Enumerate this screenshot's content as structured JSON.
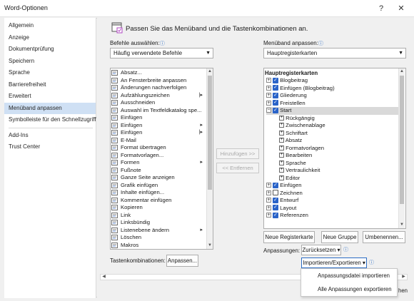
{
  "window": {
    "title": "Word-Optionen",
    "help": "?",
    "close": "✕"
  },
  "nav": {
    "items": [
      "Allgemein",
      "Anzeige",
      "Dokumentprüfung",
      "Speichern",
      "Sprache",
      "Barrierefreiheit",
      "Erweitert",
      "Menüband anpassen",
      "Symbolleiste für den Schnellzugriff"
    ],
    "items2": [
      "Add-Ins",
      "Trust Center"
    ],
    "selected_index": 7
  },
  "header": {
    "text": "Passen Sie das Menüband und die Tastenkombinationen an."
  },
  "left": {
    "label": "Befehle auswählen:",
    "select_value": "Häufig verwendete Befehle",
    "commands": [
      {
        "label": "Absatz...",
        "icon": "paragraph-icon",
        "sub": ""
      },
      {
        "label": "An Fensterbreite anpassen",
        "icon": "fit-width-icon",
        "sub": ""
      },
      {
        "label": "Änderungen nachverfolgen",
        "icon": "track-changes-icon",
        "sub": ""
      },
      {
        "label": "Aufzählungszeichen",
        "icon": "bullets-icon",
        "sub": "|▸"
      },
      {
        "label": "Ausschneiden",
        "icon": "cut-icon",
        "sub": ""
      },
      {
        "label": "Auswahl im Textfeldkatalog spe...",
        "icon": "textbox-icon",
        "sub": ""
      },
      {
        "label": "Einfügen",
        "icon": "paste-icon",
        "sub": ""
      },
      {
        "label": "Einfügen",
        "icon": "paste-icon",
        "sub": "▸"
      },
      {
        "label": "Einfügen",
        "icon": "paste-icon",
        "sub": "|▸"
      },
      {
        "label": "E-Mail",
        "icon": "email-icon",
        "sub": ""
      },
      {
        "label": "Format übertragen",
        "icon": "format-painter-icon",
        "sub": ""
      },
      {
        "label": "Formatvorlagen...",
        "icon": "styles-icon",
        "sub": ""
      },
      {
        "label": "Formen",
        "icon": "shapes-icon",
        "sub": "▸"
      },
      {
        "label": "Fußnote",
        "icon": "footnote-icon",
        "sub": ""
      },
      {
        "label": "Ganze Seite anzeigen",
        "icon": "whole-page-icon",
        "sub": ""
      },
      {
        "label": "Grafik einfügen",
        "icon": "picture-icon",
        "sub": ""
      },
      {
        "label": "Inhalte einfügen...",
        "icon": "paste-special-icon",
        "sub": ""
      },
      {
        "label": "Kommentar einfügen",
        "icon": "comment-icon",
        "sub": ""
      },
      {
        "label": "Kopieren",
        "icon": "copy-icon",
        "sub": ""
      },
      {
        "label": "Link",
        "icon": "link-icon",
        "sub": ""
      },
      {
        "label": "Linksbündig",
        "icon": "align-left-icon",
        "sub": ""
      },
      {
        "label": "Listenebene ändern",
        "icon": "list-level-icon",
        "sub": "▸"
      },
      {
        "label": "Löschen",
        "icon": "delete-icon",
        "sub": ""
      },
      {
        "label": "Makros",
        "icon": "macros-icon",
        "sub": ""
      }
    ],
    "shortcut_label": "Tastenkombinationen:",
    "shortcut_button": "Anpassen..."
  },
  "middle": {
    "add": "Hinzufügen >>",
    "remove": "<< Entfernen"
  },
  "right": {
    "label": "Menüband anpassen:",
    "select_value": "Hauptregisterkarten",
    "tree_header": "Hauptregisterkarten",
    "tabs_before": [
      "Blogbeitrag",
      "Einfügen (Blogbeitrag)",
      "Gliederung",
      "Freistellen"
    ],
    "start": "Start",
    "groups": [
      "Rückgängig",
      "Zwischenablage",
      "Schriftart",
      "Absatz",
      "Formatvorlagen",
      "Bearbeiten",
      "Sprache",
      "Vertraulichkeit",
      "Editor"
    ],
    "tabs_after": [
      {
        "label": "Einfügen",
        "checked": true
      },
      {
        "label": "Zeichnen",
        "checked": false
      },
      {
        "label": "Entwurf",
        "checked": true
      },
      {
        "label": "Layout",
        "checked": true
      },
      {
        "label": "Referenzen",
        "checked": true
      }
    ],
    "btn_new_tab": "Neue Registerkarte",
    "btn_new_group": "Neue Gruppe",
    "btn_rename": "Umbenennen...",
    "reset_label": "Anpassungen:",
    "reset_button": "Zurücksetzen ▾",
    "import_export": "Importieren/Exportieren ▾"
  },
  "menu": {
    "items": [
      "Anpassungsdatei importieren",
      "Alle Anpassungen exportieren"
    ]
  },
  "clipped": {
    "behind_menu": "hen"
  },
  "colors": {
    "accent": "#2a63c8",
    "selected_nav": "#cfe0f4",
    "link": "#2b6cc4"
  }
}
